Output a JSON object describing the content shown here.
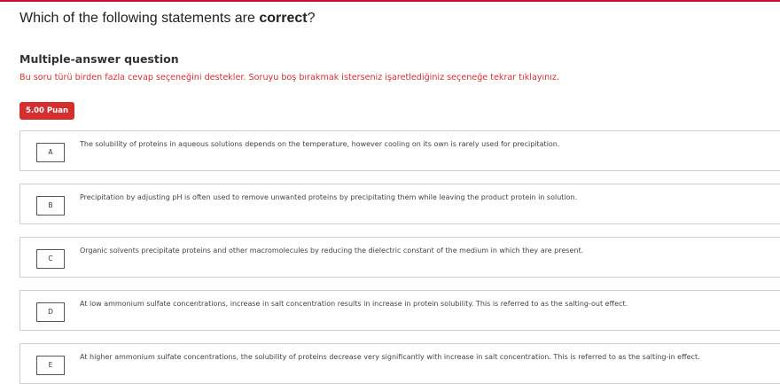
{
  "question": {
    "text_prefix": "Which of the following statements are ",
    "text_bold": "correct",
    "text_suffix": "?"
  },
  "question_type": "Multiple-answer question",
  "hint": "Bu soru türü birden fazla cevap seçeneğini destekler. Soruyu boş bırakmak isterseniz işaretlediğiniz seçeneğe tekrar tıklayınız.",
  "points": "5.00 Puan",
  "colors": {
    "accent": "#d32f2f",
    "top_bar": "#c8102e"
  },
  "options": [
    {
      "letter": "A",
      "text": "The solubility of proteins in aqueous solutions depends on the temperature, however cooling on its own is rarely used for precipitation."
    },
    {
      "letter": "B",
      "text": "Precipitation by adjusting pH is often used to remove unwanted proteins by precipitating them while leaving the product protein in solution."
    },
    {
      "letter": "C",
      "text": "Organic solvents precipitate proteins and other macromolecules by reducing the dielectric constant of the medium in which they are present."
    },
    {
      "letter": "D",
      "text": "At low ammonium sulfate concentrations, increase in salt concentration results in increase in protein solubility. This is referred to as the salting-out effect."
    },
    {
      "letter": "E",
      "text": "At higher ammonium sulfate concentrations, the solubility of proteins decrease very significantly with increase in salt concentration. This is referred to as the salting-in effect."
    }
  ]
}
